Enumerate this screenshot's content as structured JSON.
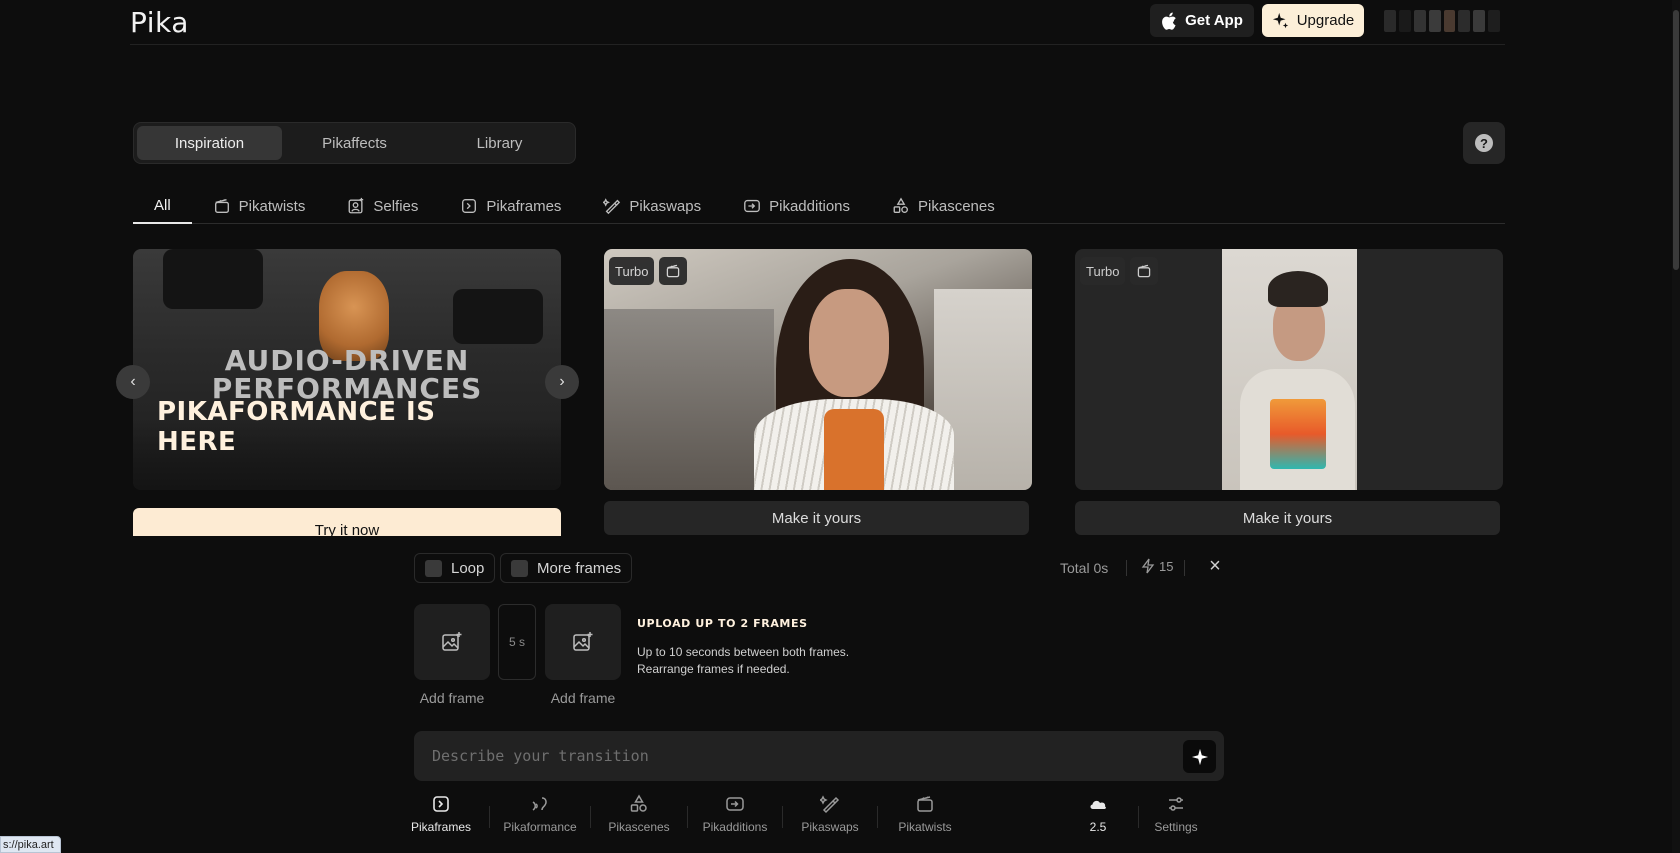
{
  "header": {
    "logo": "Pika",
    "get_app_label": "Get App",
    "upgrade_label": "Upgrade"
  },
  "top_tabs": [
    "Inspiration",
    "Pikaffects",
    "Library"
  ],
  "category_tabs": [
    "All",
    "Pikatwists",
    "Selfies",
    "Pikaframes",
    "Pikaswaps",
    "Pikadditions",
    "Pikascenes"
  ],
  "cards": {
    "banner": {
      "line1": "AUDIO-DRIVEN",
      "line2": "PERFORMANCES",
      "line3": "PIKAFORMANCE IS",
      "line4": "HERE",
      "cta": "Try it now"
    },
    "card2": {
      "badge": "Turbo",
      "cta": "Make it yours"
    },
    "card3": {
      "badge": "Turbo",
      "cta": "Make it yours"
    }
  },
  "panel": {
    "loop_label": "Loop",
    "more_frames_label": "More frames",
    "total_label": "Total 0s",
    "credits": "15",
    "duration": "5 s",
    "add_frame_1": "Add frame",
    "add_frame_2": "Add frame",
    "upload_title": "UPLOAD UP TO 2 FRAMES",
    "upload_desc_1": "Up to 10 seconds between both frames.",
    "upload_desc_2": "Rearrange frames if needed.",
    "prompt_placeholder": "Describe your transition"
  },
  "toolbar": {
    "items": [
      "Pikaframes",
      "Pikaformance",
      "Pikascenes",
      "Pikadditions",
      "Pikaswaps",
      "Pikatwists"
    ],
    "model": "2.5",
    "settings": "Settings"
  },
  "status_bar": {
    "url": "s://pika.art"
  },
  "colors": {
    "accent_cream": "#fdebd3",
    "background": "#0d0d0d",
    "surface": "#262626"
  }
}
